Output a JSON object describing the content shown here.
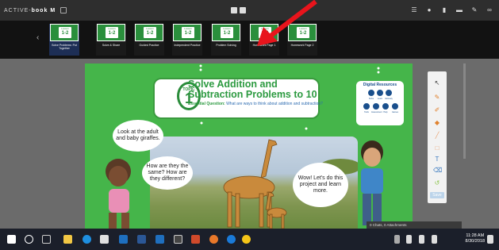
{
  "app": {
    "logo_prefix": "ACTIVE-",
    "logo_name": "book",
    "logo_suffix": "M"
  },
  "thumbnails": [
    {
      "lesson": "Lesson",
      "num": "1-2",
      "label": "Solve Problems: Put Together",
      "active": true
    },
    {
      "lesson": "Lesson",
      "num": "1-2",
      "label": "Solve & Share",
      "active": false
    },
    {
      "lesson": "Lesson",
      "num": "1-2",
      "label": "Guided Practice",
      "active": false
    },
    {
      "lesson": "Lesson",
      "num": "1-2",
      "label": "Independent Practice",
      "active": false
    },
    {
      "lesson": "Lesson",
      "num": "1-2",
      "label": "Problem Solving",
      "active": false
    },
    {
      "lesson": "Lesson",
      "num": "1-2",
      "label": "Homework Page 1",
      "active": false
    },
    {
      "lesson": "Lesson",
      "num": "1-2",
      "label": "Homework Page 2",
      "active": false
    }
  ],
  "page": {
    "topic_label": "TOPIC",
    "topic_num": "1",
    "title": "Solve Addition and Subtraction Problems to 10",
    "essential_q_label": "Essential Question:",
    "essential_q_text": "What are ways to think about addition and subtraction?",
    "digital_resources": {
      "title": "Digital Resources",
      "buttons": [
        "Solve",
        "Learn",
        "Glossary",
        "Tools",
        "Assessment",
        "Help",
        "Games"
      ]
    },
    "bubbles": {
      "b1": "Look at the adult and baby giraffes.",
      "b2": "How are they the same? How are they different?",
      "b3": "Wow! Let's do this project and learn more."
    }
  },
  "tools": {
    "save_label": "Save"
  },
  "chats_bar": "0 Chats, 0 Attachments",
  "clock": {
    "time": "11:28 AM",
    "date": "8/30/2018"
  },
  "colors": {
    "page_green": "#45b54a",
    "accent_blue": "#1a4f8c",
    "arrow_red": "#e8141c"
  }
}
